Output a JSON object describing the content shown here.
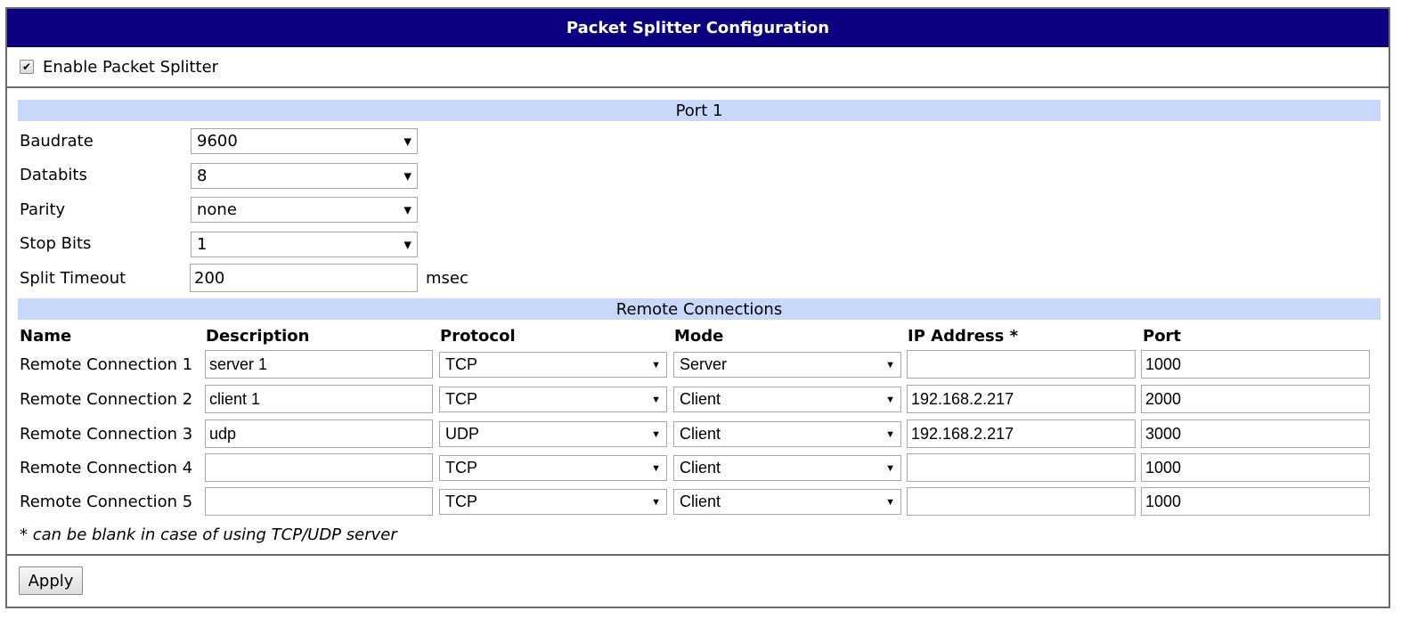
{
  "title": "Packet Splitter Configuration",
  "enable": {
    "label": "Enable Packet Splitter",
    "checked": true
  },
  "port1": {
    "heading": "Port 1",
    "baudrate": {
      "label": "Baudrate",
      "value": "9600"
    },
    "databits": {
      "label": "Databits",
      "value": "8"
    },
    "parity": {
      "label": "Parity",
      "value": "none"
    },
    "stopbits": {
      "label": "Stop Bits",
      "value": "1"
    },
    "split_timeout": {
      "label": "Split Timeout",
      "value": "200",
      "unit": "msec"
    }
  },
  "remote": {
    "heading": "Remote Connections",
    "columns": [
      "Name",
      "Description",
      "Protocol",
      "Mode",
      "IP Address *",
      "Port"
    ],
    "rows": [
      {
        "name": "Remote Connection 1",
        "description": "server 1",
        "protocol": "TCP",
        "mode": "Server",
        "ip": "",
        "port": "1000"
      },
      {
        "name": "Remote Connection 2",
        "description": "client 1",
        "protocol": "TCP",
        "mode": "Client",
        "ip": "192.168.2.217",
        "port": "2000"
      },
      {
        "name": "Remote Connection 3",
        "description": "udp",
        "protocol": "UDP",
        "mode": "Client",
        "ip": "192.168.2.217",
        "port": "3000"
      },
      {
        "name": "Remote Connection 4",
        "description": "",
        "protocol": "TCP",
        "mode": "Client",
        "ip": "",
        "port": "1000"
      },
      {
        "name": "Remote Connection 5",
        "description": "",
        "protocol": "TCP",
        "mode": "Client",
        "ip": "",
        "port": "1000"
      }
    ],
    "note": "* can be blank in case of using TCP/UDP server"
  },
  "apply_label": "Apply",
  "icons": {
    "checkbox": "checkmark-icon",
    "dropdown": "chevron-down-icon"
  }
}
